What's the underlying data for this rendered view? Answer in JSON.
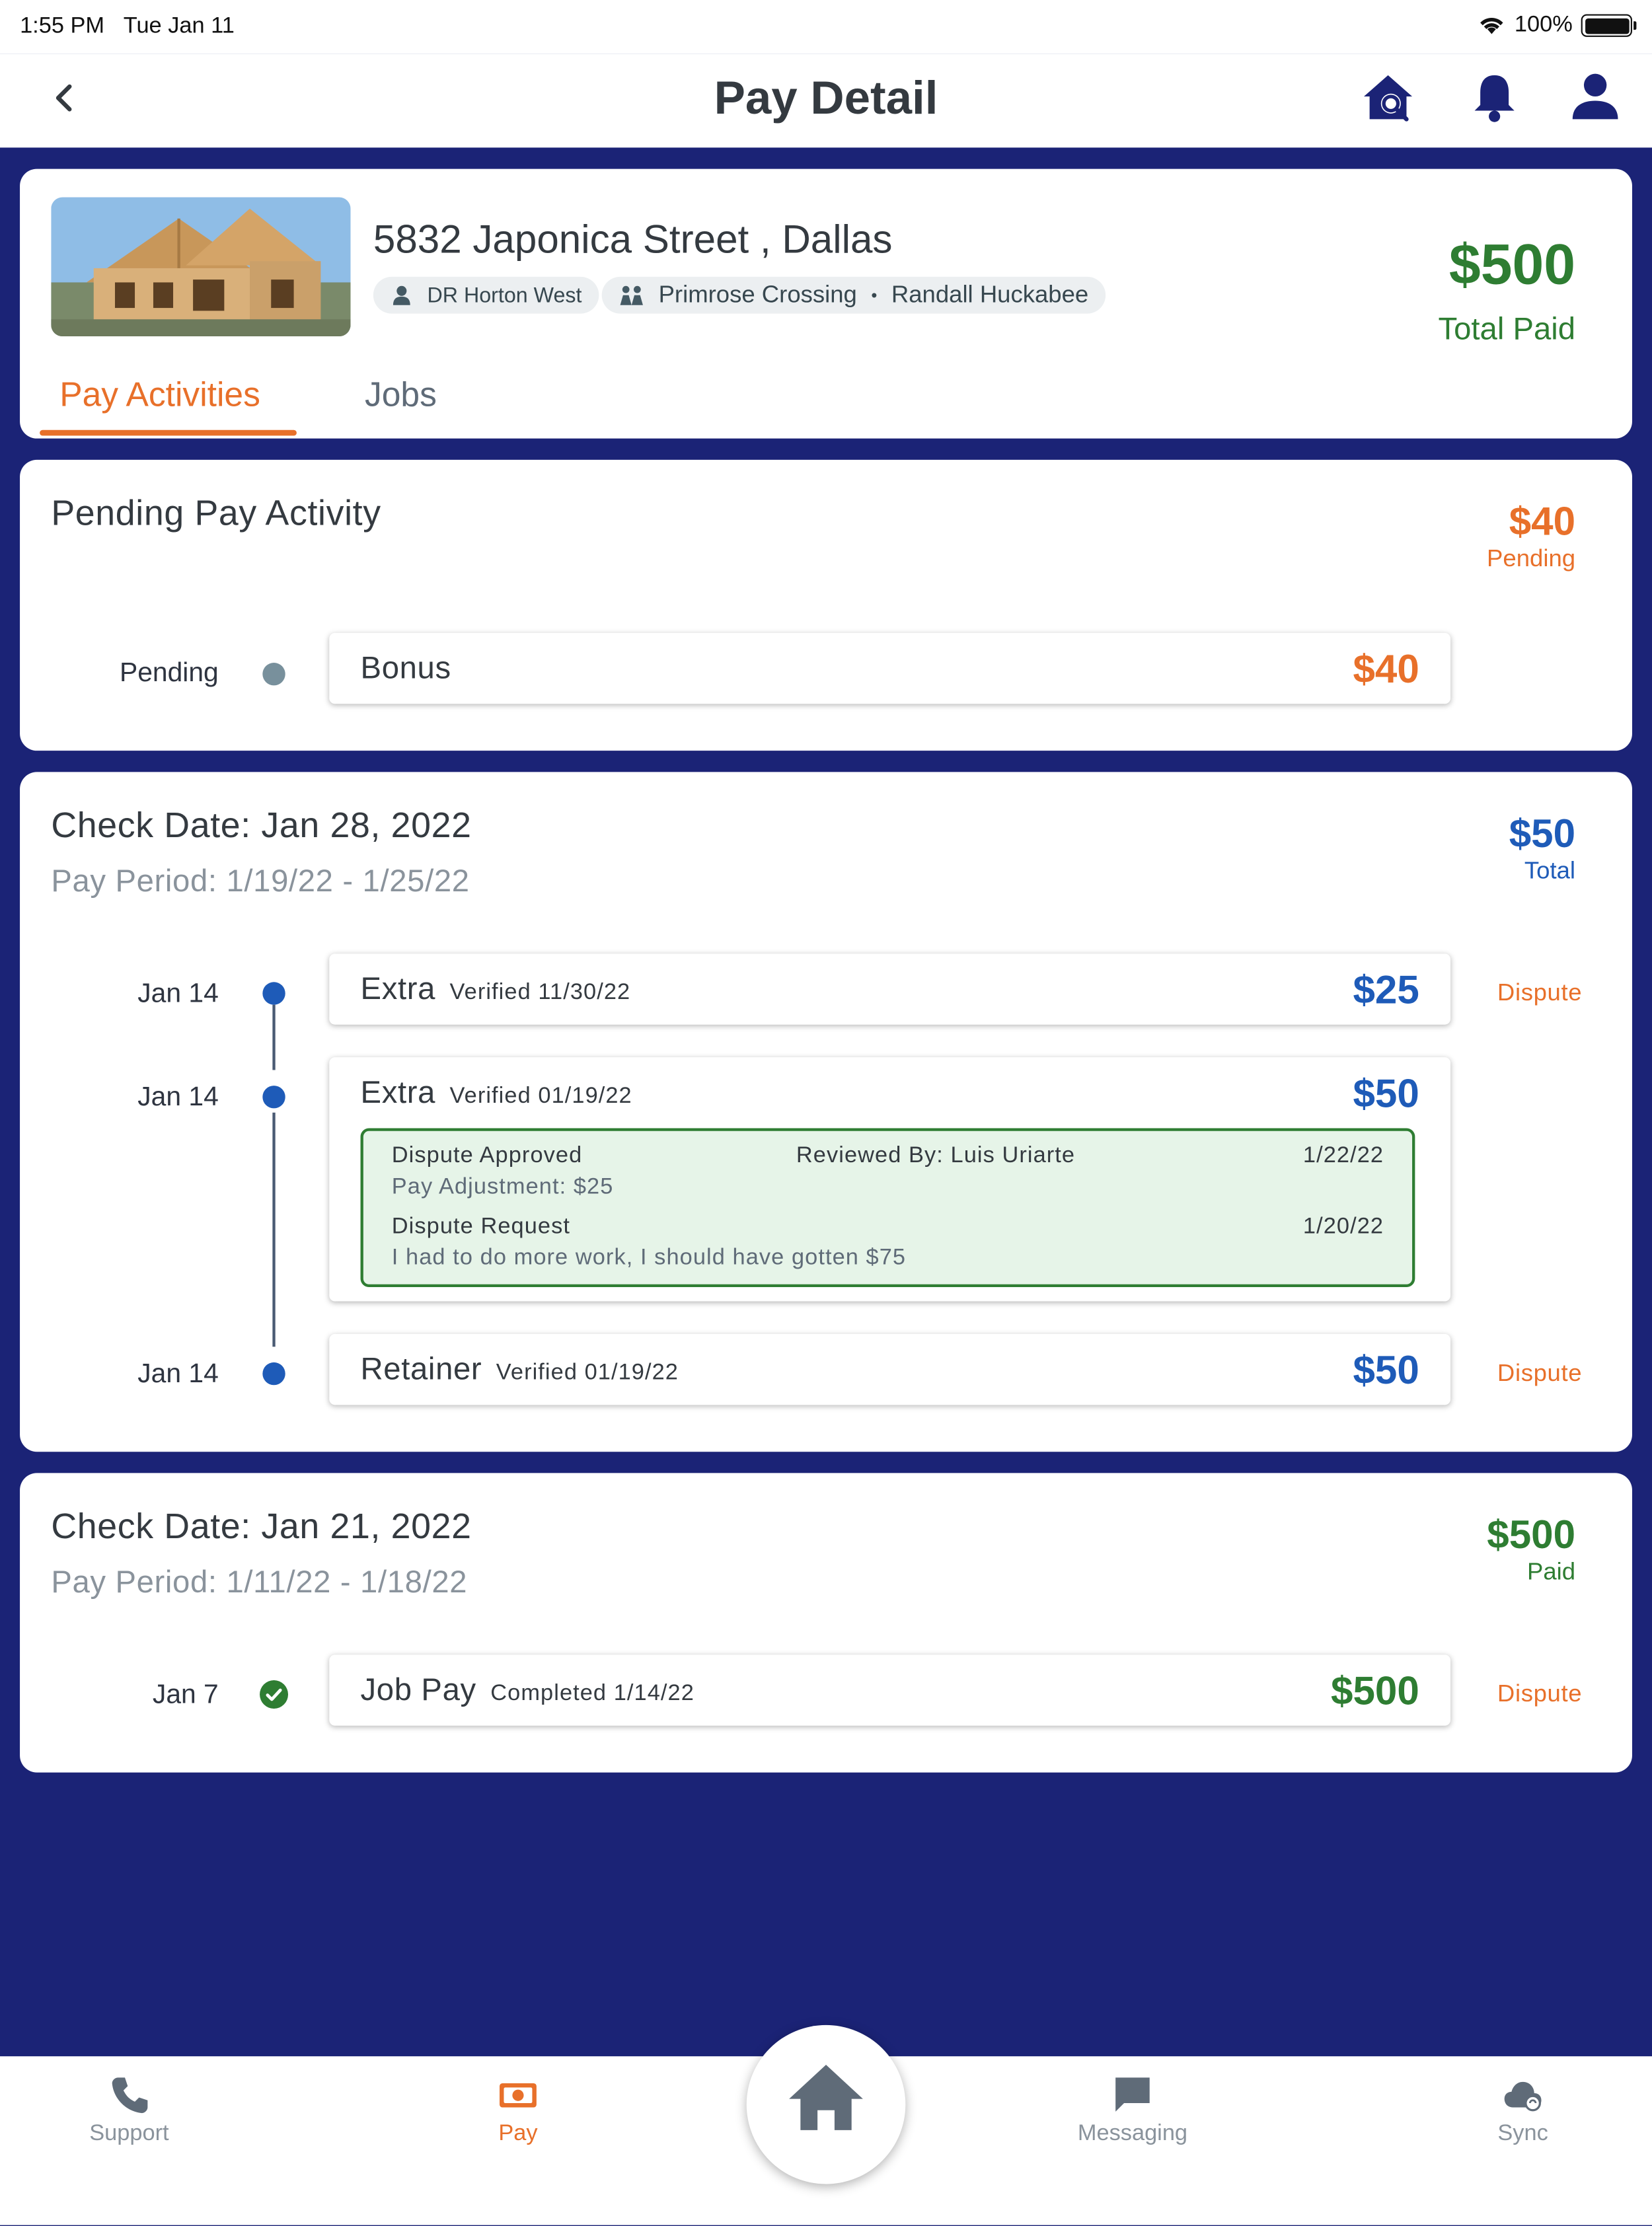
{
  "status": {
    "time": "1:55 PM",
    "date": "Tue Jan 11",
    "battery": "100%"
  },
  "header": {
    "title": "Pay Detail"
  },
  "property": {
    "address": "5832 Japonica Street , Dallas",
    "builder": "DR Horton West",
    "community": "Primrose Crossing",
    "supervisor": "Randall Huckabee",
    "total_amount": "$500",
    "total_label": "Total Paid"
  },
  "tabs": [
    {
      "label": "Pay Activities",
      "active": true
    },
    {
      "label": "Jobs",
      "active": false
    }
  ],
  "pending": {
    "title": "Pending Pay Activity",
    "amount": "$40",
    "amount_label": "Pending",
    "items": [
      {
        "date": "Pending",
        "name": "Bonus",
        "amount": "$40"
      }
    ]
  },
  "check1": {
    "title": "Check Date: Jan 28, 2022",
    "period": "Pay Period: 1/19/22 - 1/25/22",
    "amount": "$50",
    "amount_label": "Total",
    "items": [
      {
        "date": "Jan 14",
        "name": "Extra",
        "verified": "Verified 11/30/22",
        "amount": "$25",
        "action": "Dispute"
      },
      {
        "date": "Jan 14",
        "name": "Extra",
        "verified": "Verified 01/19/22",
        "amount": "$50",
        "dispute": {
          "approved_label": "Dispute Approved",
          "reviewed_by": "Reviewed By: Luis Uriarte",
          "approved_date": "1/22/22",
          "adjustment": "Pay Adjustment:  $25",
          "request_label": "Dispute Request",
          "request_date": "1/20/22",
          "request_text": "I had to do more work, I should have gotten $75"
        }
      },
      {
        "date": "Jan 14",
        "name": "Retainer",
        "verified": "Verified 01/19/22",
        "amount": "$50",
        "action": "Dispute"
      }
    ]
  },
  "check2": {
    "title": "Check Date: Jan 21, 2022",
    "period": "Pay Period: 1/11/22 - 1/18/22",
    "amount": "$500",
    "amount_label": "Paid",
    "items": [
      {
        "date": "Jan 7",
        "name": "Job Pay",
        "verified": "Completed 1/14/22",
        "amount": "$500",
        "action": "Dispute"
      }
    ]
  },
  "nav": {
    "support": "Support",
    "pay": "Pay",
    "messaging": "Messaging",
    "sync": "Sync"
  },
  "colors": {
    "background": "#1b2376",
    "accent_orange": "#e8702a",
    "paid_green": "#2e7d32",
    "verified_blue": "#1e5bb8",
    "pending_gray": "#78909c"
  },
  "icons": [
    "back-arrow-icon",
    "home-search-icon",
    "bell-icon",
    "user-icon",
    "person-icon",
    "community-icon",
    "check-circle-icon",
    "phone-icon",
    "money-icon",
    "home-icon",
    "chat-icon",
    "cloud-sync-icon"
  ]
}
